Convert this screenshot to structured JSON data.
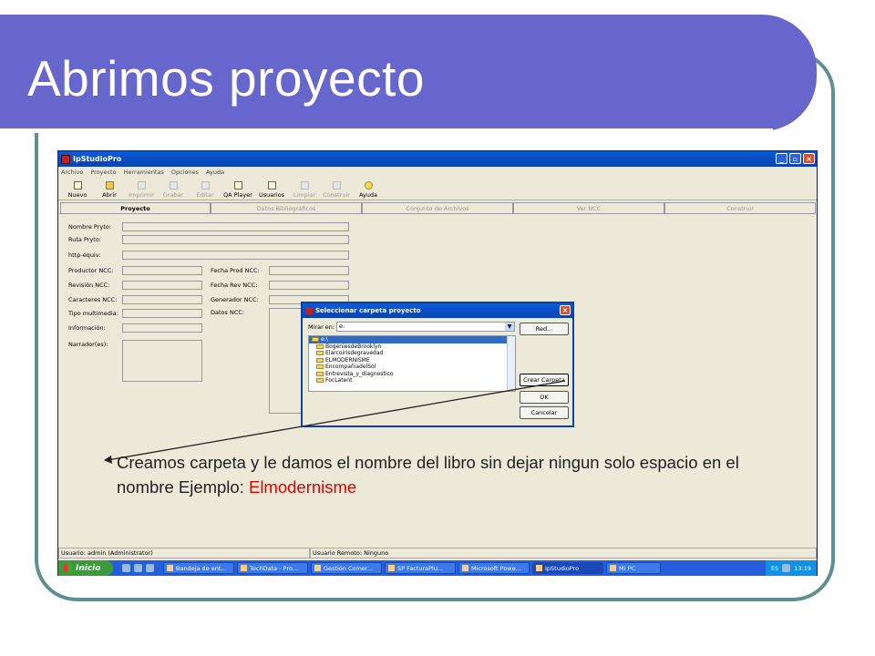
{
  "slide": {
    "title": "Abrimos proyecto",
    "annotation_text": "Creamos carpeta y le damos el nombre del libro sin dejar ningun solo espacio en el nombre Ejemplo:  ",
    "annotation_example": "Elmodernisme"
  },
  "window": {
    "title": "IpStudioPro",
    "menu": [
      "Archivo",
      "Proyecto",
      "Herramientas",
      "Opciones",
      "Ayuda"
    ],
    "toolbar": [
      {
        "label": "Nuevo",
        "enabled": true
      },
      {
        "label": "Abrir",
        "enabled": true
      },
      {
        "label": "Imprimir",
        "enabled": false
      },
      {
        "label": "Grabar",
        "enabled": false
      },
      {
        "label": "Editar",
        "enabled": false
      },
      {
        "label": "QA Player",
        "enabled": true
      },
      {
        "label": "Usuarios",
        "enabled": true
      },
      {
        "label": "Limpiar",
        "enabled": false
      },
      {
        "label": "Construir",
        "enabled": false
      },
      {
        "label": "Ayuda",
        "enabled": true
      }
    ],
    "tabs": [
      "Proyecto",
      "Datos Bibliográficos",
      "Conjunto de Archivos",
      "Ver NCC",
      "Construir"
    ],
    "active_tab": "Proyecto",
    "form_labels": {
      "nombre": "Nombre Pryto:",
      "ruta": "Ruta Pryto:",
      "http": "http-equiv:",
      "productor": "Productor NCC:",
      "revision": "Revisión NCC:",
      "caracteres": "Caracteres NCC:",
      "tipo": "Tipo multimedia:",
      "informacion": "Información:",
      "narrador": "Narrador(es):",
      "fecha_prod": "Fecha Prod NCC:",
      "fecha_rev": "Fecha Rev NCC:",
      "generador": "Generador NCC:",
      "datos": "Datos NCC:"
    },
    "status": {
      "user": "Usuario: admin (Administrator)",
      "remote": "Usuario Remoto: Ninguno"
    }
  },
  "dialog": {
    "title": "Seleccionar carpeta proyecto",
    "look_in_label": "Mirar en:",
    "look_in_value": "e:",
    "folders": [
      "e:\\",
      "BogeniesdeBrooklyn",
      "Elarcoirisdegravedad",
      "ELMODERNISME",
      "EncompañiadelSol",
      "Entrevista_y_diagnostico",
      "FocLatent"
    ],
    "selected_folder": "e:\\",
    "buttons": {
      "network": "Red...",
      "create": "Crear Carpeta",
      "ok": "OK",
      "cancel": "Cancelar"
    }
  },
  "taskbar": {
    "start": "Inicio",
    "tasks": [
      "Bandeja de ent...",
      "TechData - Pro...",
      "Gestión Comer...",
      "SP FacturaPlu...",
      "Microsoft Powe...",
      "IpStudioPro",
      "Mi PC"
    ],
    "language": "ES",
    "clock": "13:19"
  },
  "colors": {
    "title_band": "#6666cc",
    "frame_border": "#5f8f91",
    "example_text": "#e00000",
    "xp_title": "#0a5bd8"
  }
}
